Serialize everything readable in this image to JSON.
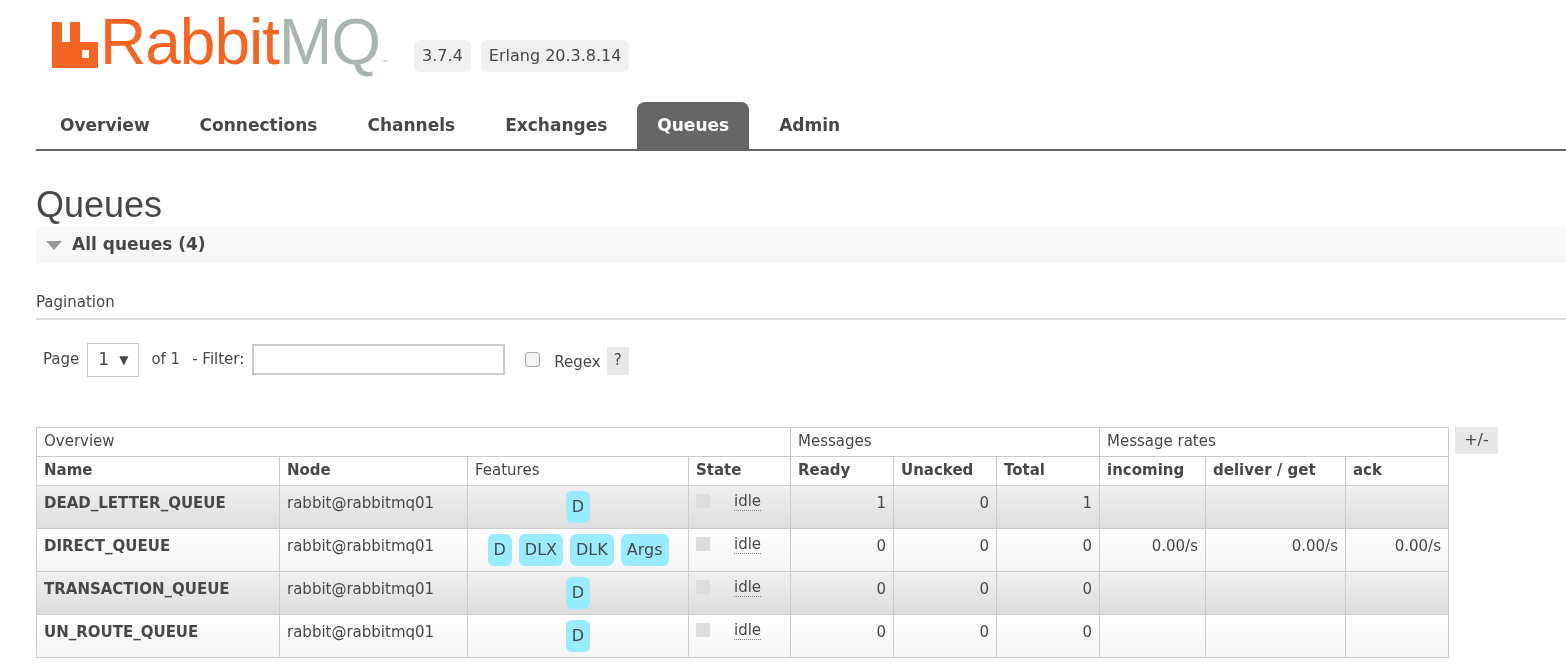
{
  "logo": {
    "word_orange": "Rabbit",
    "word_grey": "MQ",
    "trademark": "™"
  },
  "versions": [
    "3.7.4",
    "Erlang 20.3.8.14"
  ],
  "tabs": [
    {
      "label": "Overview",
      "selected": false
    },
    {
      "label": "Connections",
      "selected": false
    },
    {
      "label": "Channels",
      "selected": false
    },
    {
      "label": "Exchanges",
      "selected": false
    },
    {
      "label": "Queues",
      "selected": true
    },
    {
      "label": "Admin",
      "selected": false
    }
  ],
  "page_title": "Queues",
  "section": {
    "title": "All queues (4)",
    "expanded": true
  },
  "pagination": {
    "title": "Pagination",
    "page_label": "Page",
    "page_value": "1",
    "page_caret": "▼",
    "of_label": "of 1",
    "filter_label": "- Filter:",
    "regex_label": "Regex",
    "regex_checked": false,
    "help": "?"
  },
  "table": {
    "groups": [
      "Overview",
      "Messages",
      "Message rates"
    ],
    "toggle": "+/-",
    "columns": [
      "Name",
      "Node",
      "Features",
      "State",
      "Ready",
      "Unacked",
      "Total",
      "incoming",
      "deliver / get",
      "ack"
    ],
    "rows": [
      {
        "name": "DEAD_LETTER_QUEUE",
        "node": "rabbit@rabbitmq01",
        "features": [
          "D"
        ],
        "state": "idle",
        "ready": "1",
        "unacked": "0",
        "total": "1"
      },
      {
        "name": "DIRECT_QUEUE",
        "node": "rabbit@rabbitmq01",
        "features": [
          "D",
          "DLX",
          "DLK",
          "Args"
        ],
        "state": "idle",
        "ready": "0",
        "unacked": "0",
        "total": "0",
        "rates": {
          "incoming": "0.00/s",
          "deliver_get": "0.00/s",
          "ack": "0.00/s"
        }
      },
      {
        "name": "TRANSACTION_QUEUE",
        "node": "rabbit@rabbitmq01",
        "features": [
          "D"
        ],
        "state": "idle",
        "ready": "0",
        "unacked": "0",
        "total": "0"
      },
      {
        "name": "UN_ROUTE_QUEUE",
        "node": "rabbit@rabbitmq01",
        "features": [
          "D"
        ],
        "state": "idle",
        "ready": "0",
        "unacked": "0",
        "total": "0"
      }
    ]
  }
}
